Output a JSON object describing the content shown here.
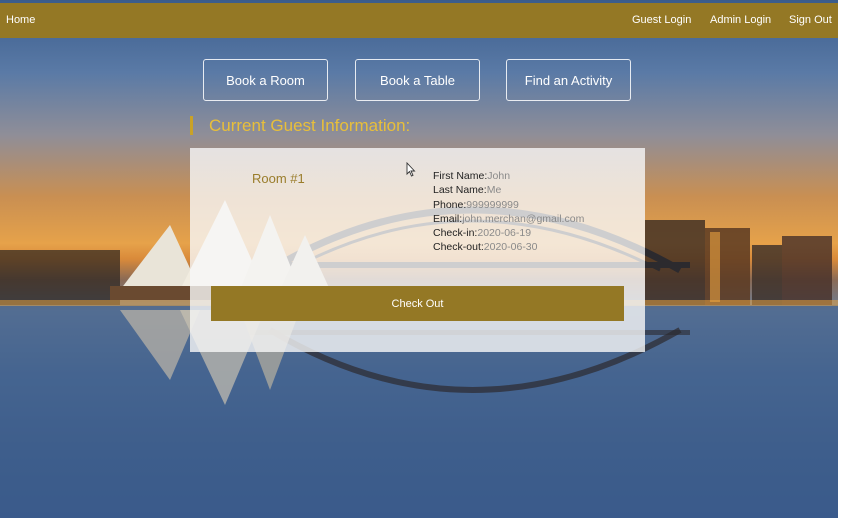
{
  "nav": {
    "home": "Home",
    "guest_login": "Guest Login",
    "admin_login": "Admin Login",
    "sign_out": "Sign Out"
  },
  "actions": {
    "book_room": "Book a Room",
    "book_table": "Book a Table",
    "find_activity": "Find an Activity"
  },
  "section": {
    "title": "Current Guest Information:"
  },
  "guest": {
    "room_label": "Room #1",
    "fields": [
      {
        "label": "First Name:",
        "value": "John"
      },
      {
        "label": "Last Name:",
        "value": "Me"
      },
      {
        "label": "Phone:",
        "value": "999999999"
      },
      {
        "label": "Email:",
        "value": "john.merchan@gmail.com"
      },
      {
        "label": "Check-in:",
        "value": "2020-06-19"
      },
      {
        "label": "Check-out:",
        "value": "2020-06-30"
      }
    ],
    "checkout_label": "Check Out"
  },
  "colors": {
    "brand": "#947825",
    "title": "#e8bf3a",
    "room_label": "#9a7d2b"
  }
}
